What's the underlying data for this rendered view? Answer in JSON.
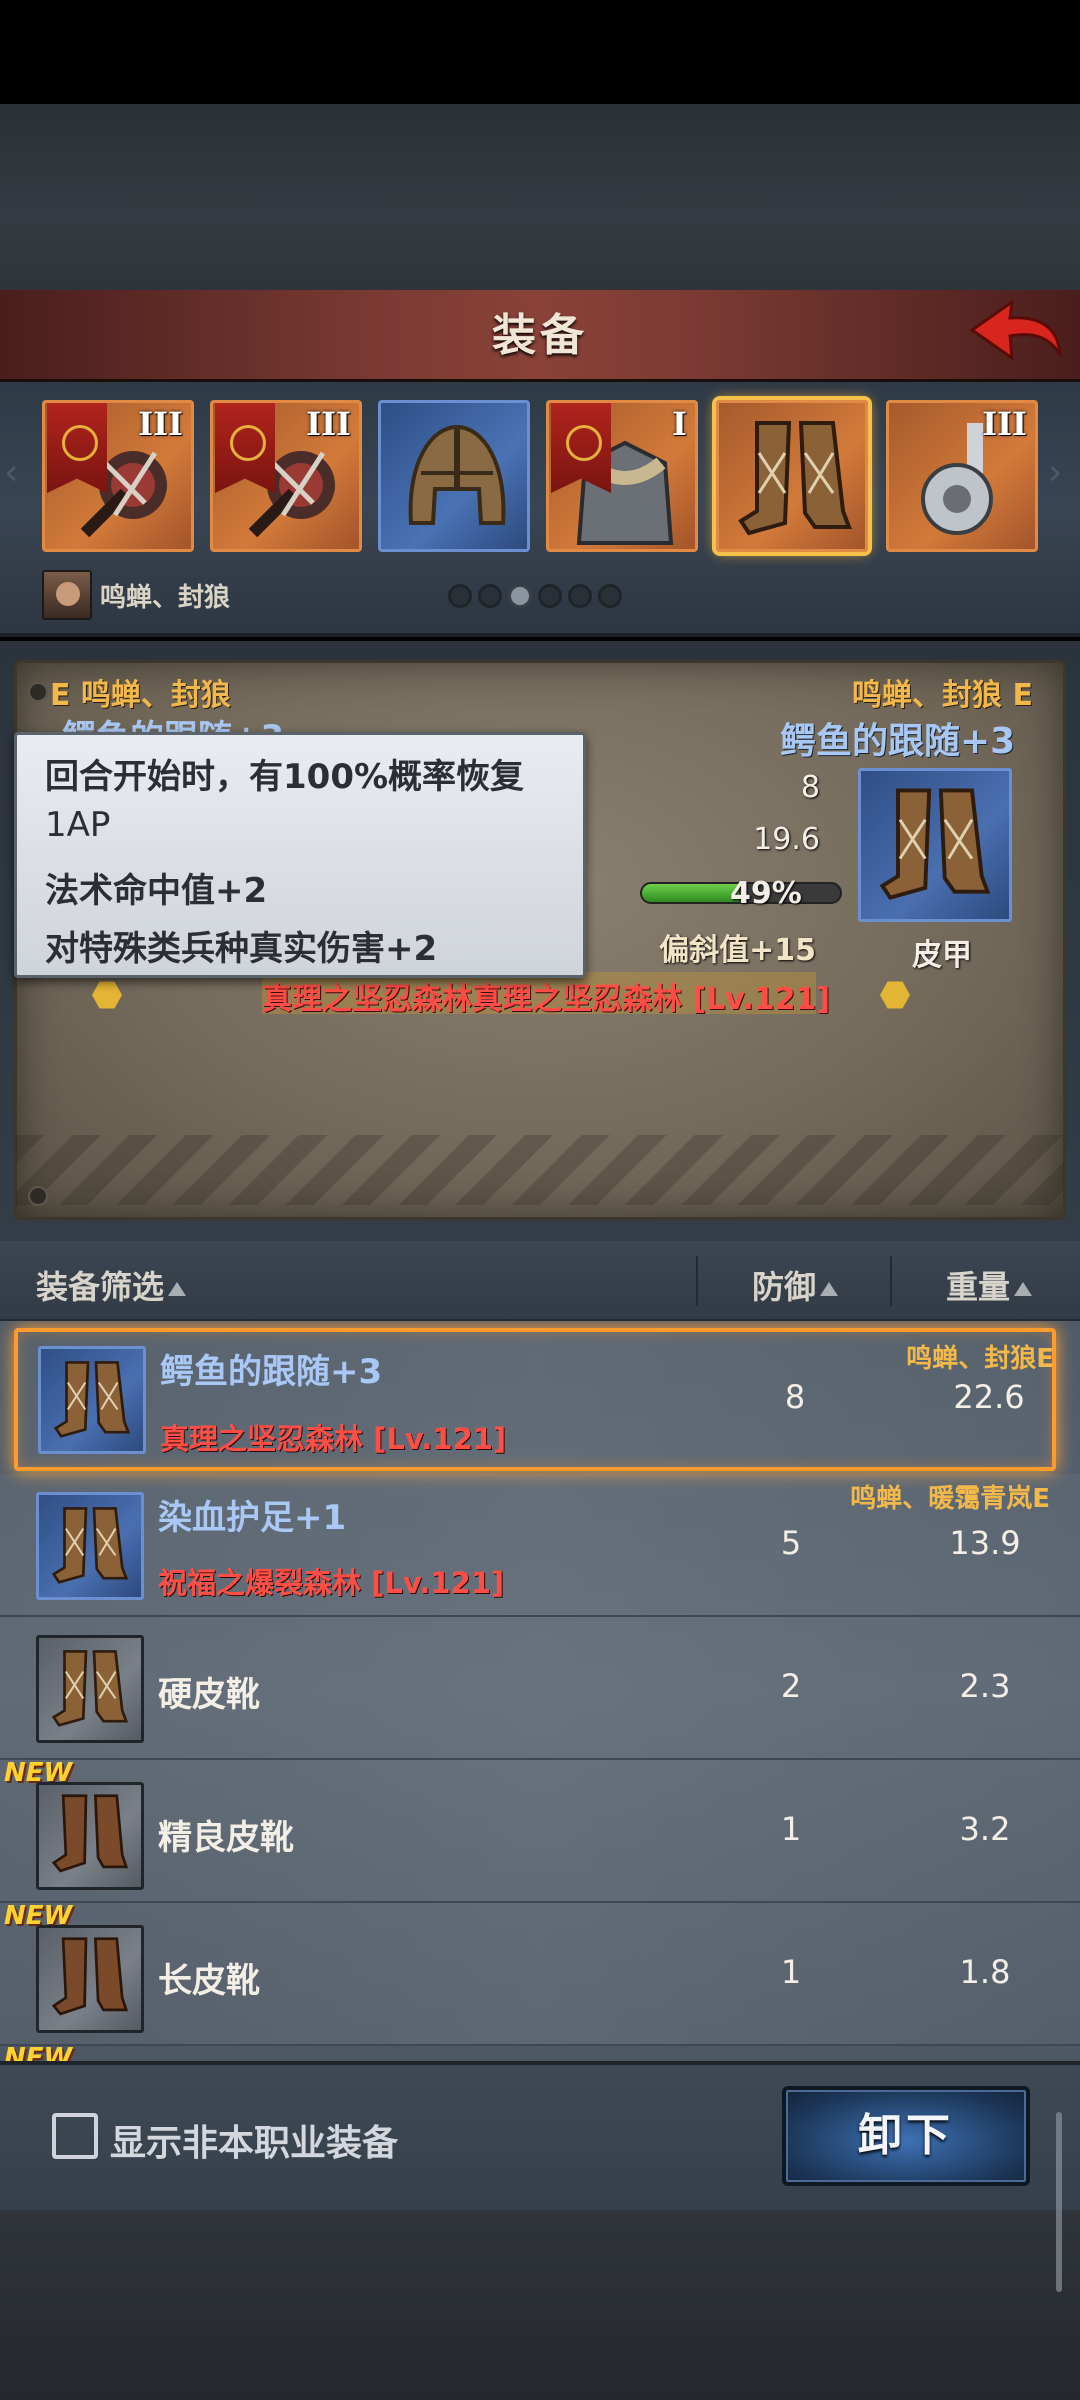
{
  "header": {
    "title": "装备"
  },
  "slots": [
    {
      "name": "weapon-slot-1",
      "tier": "III",
      "icon": "mace-icon"
    },
    {
      "name": "weapon-slot-2",
      "tier": "III",
      "icon": "mace-icon"
    },
    {
      "name": "helmet-slot",
      "tier": "",
      "icon": "helmet-icon"
    },
    {
      "name": "armor-slot",
      "tier": "I",
      "icon": "fur-armor-icon"
    },
    {
      "name": "boots-slot",
      "tier": "",
      "icon": "leather-boots-icon"
    },
    {
      "name": "accessory-slot",
      "tier": "III",
      "icon": "pipe-accessory-icon"
    }
  ],
  "character": {
    "name": "鸣蝉、封狼"
  },
  "page_indicator": {
    "total": 6,
    "active": 3
  },
  "compare": {
    "left_set": "E 鸣蝉、封狼",
    "left_name": "鳄鱼的跟随+3",
    "right_set": "鸣蝉、封狼 E",
    "right_name": "鳄鱼的跟随+3",
    "defense": "8",
    "weight": "19.6",
    "durability_percent": 49,
    "durability_text": "49%",
    "stat": "偏斜值+15",
    "set_bonus": "真理之坚忍森林真理之坚忍森林 [Lv.121]",
    "type": "皮甲"
  },
  "tooltip": {
    "line1": "回合开始时，有100%概率恢复",
    "line2": "1AP",
    "line3": "法术命中值+2",
    "line4": "对特殊类兵种真实伤害+2"
  },
  "list_header": {
    "filter": "装备筛选",
    "defense": "防御",
    "weight": "重量"
  },
  "items": [
    {
      "name": "鳄鱼的跟随+3",
      "sub": "真理之坚忍森林 [Lv.121]",
      "set": "鸣蝉、封狼E",
      "defense": "8",
      "weight": "22.6",
      "rarity": "blue",
      "new": false,
      "selected": true
    },
    {
      "name": "染血护足+1",
      "sub": "祝福之爆裂森林 [Lv.121]",
      "set": "鸣蝉、暖霭青岚E",
      "defense": "5",
      "weight": "13.9",
      "rarity": "blue",
      "new": false,
      "selected": false
    },
    {
      "name": "硬皮靴",
      "sub": "",
      "set": "",
      "defense": "2",
      "weight": "2.3",
      "rarity": "gray",
      "new": false,
      "selected": false
    },
    {
      "name": "精良皮靴",
      "sub": "",
      "set": "",
      "defense": "1",
      "weight": "3.2",
      "rarity": "gray",
      "new": true,
      "selected": false
    },
    {
      "name": "长皮靴",
      "sub": "",
      "set": "",
      "defense": "1",
      "weight": "1.8",
      "rarity": "gray",
      "new": true,
      "selected": false
    }
  ],
  "new_badge": "NEW",
  "footer": {
    "checkbox_label": "显示非本职业装备",
    "unequip_label": "卸下"
  },
  "colors": {
    "header_red": "#7a3a33",
    "rare_blue": "#4a6fb0",
    "set_gold": "#f2b94a",
    "set_bonus_red": "#ff4d46",
    "selected_orange": "#ff9a2e"
  }
}
